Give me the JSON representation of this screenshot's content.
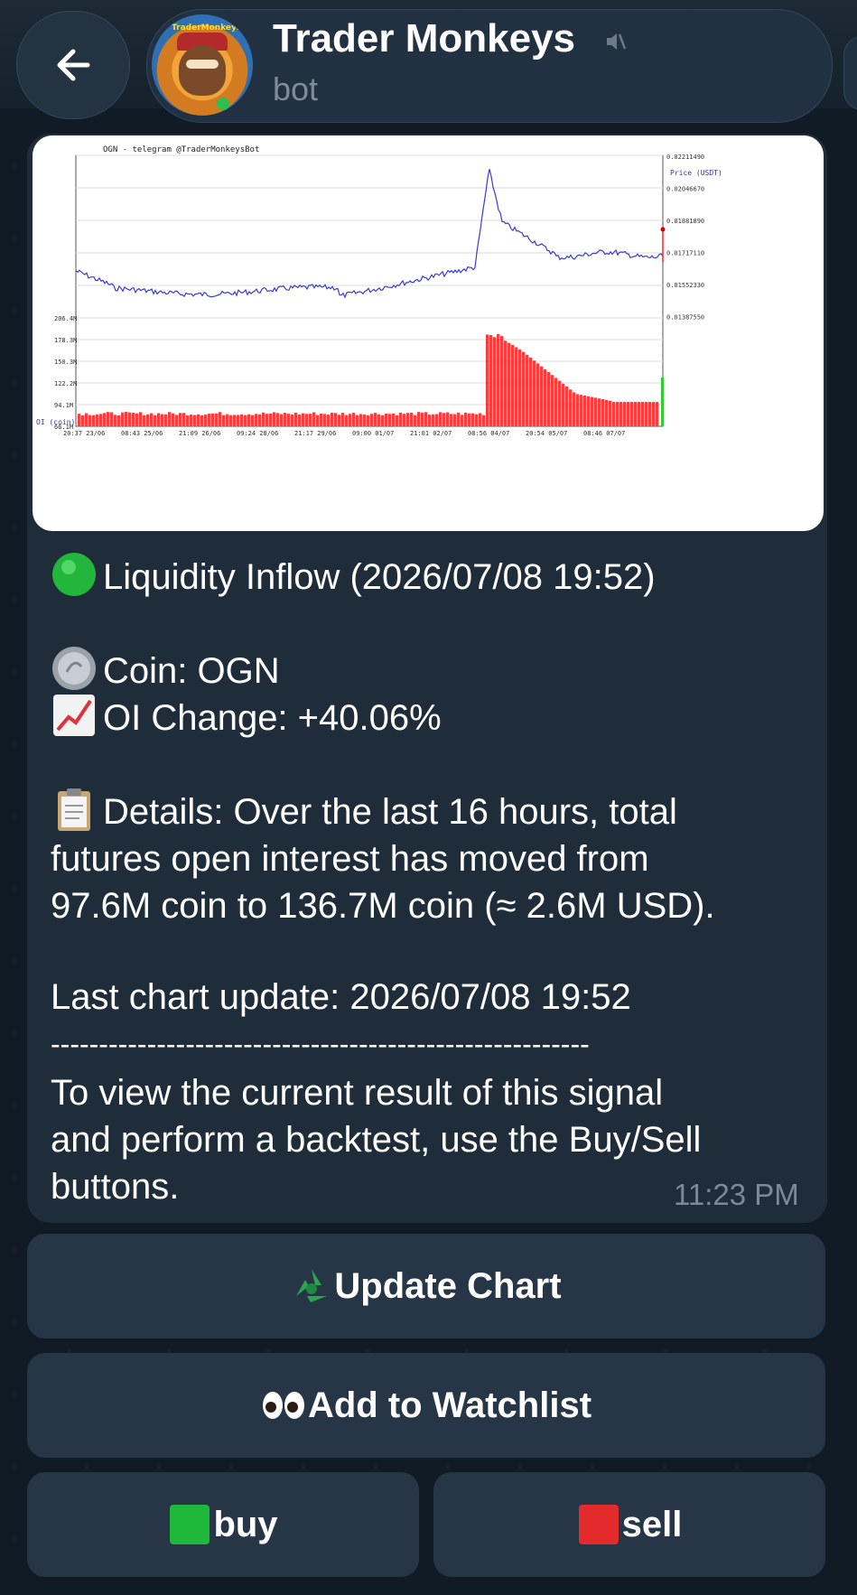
{
  "header": {
    "title": "Trader Monkeys",
    "subtitle": "bot",
    "avatar_text": "TraderMonkeysBot"
  },
  "chart_image": {
    "title": "OGN - telegram @TraderMonkeysBot",
    "price_label": "Price (USDT)",
    "oi_label": "OI (coin)",
    "price_ticks": [
      "0.02211490",
      "0.02046670",
      "0.01881890",
      "0.01717110",
      "0.01552330",
      "0.01387550"
    ],
    "oi_ticks": [
      "206.4M",
      "178.3M",
      "150.3M",
      "122.2M",
      "94.1M",
      "66.1M"
    ],
    "x_ticks": [
      "20:37 23/06",
      "08:43 25/06",
      "21:09 26/06",
      "09:24 28/06",
      "21:17 29/06",
      "09:00 01/07",
      "21:01 02/07",
      "08:56 04/07",
      "20:54 05/07",
      "08:46 07/07"
    ]
  },
  "message": {
    "headline": "Liquidity Inflow (2026/07/08 19:52)",
    "coin": "Coin: OGN",
    "oi_change": "OI Change: +40.06%",
    "details_l1": "Details: Over the last 16 hours, total",
    "details_l2": "futures open interest has moved from",
    "details_l3": "97.6M coin to 136.7M coin (≈ 2.6M USD).",
    "last_update": "Last chart update: 2026/07/08 19:52",
    "divider": "--------------------------------------------------------",
    "footer_l1": "To view the current result of this signal",
    "footer_l2": "and perform a backtest, use the Buy/Sell",
    "footer_l3": "buttons.",
    "time": "11:23 PM"
  },
  "buttons": {
    "update": "Update Chart",
    "watchlist": "Add to Watchlist",
    "buy": "buy",
    "sell": "sell"
  },
  "colors": {
    "background": "#101b26",
    "bubble": "#1f2c39",
    "button": "#263646",
    "oi_bar": "#ff3b3b",
    "price_line": "#3b3bd6"
  }
}
